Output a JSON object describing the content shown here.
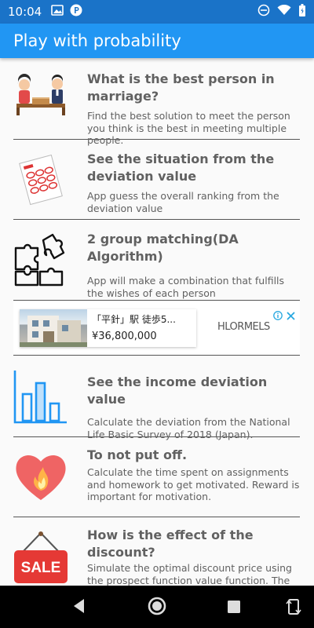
{
  "status_bar": {
    "time": "10:04",
    "left_icons": [
      "image-icon",
      "p-app-icon"
    ],
    "right_icons": [
      "do-not-disturb-icon",
      "wifi-icon",
      "battery-icon"
    ]
  },
  "app_bar": {
    "title": "Play with probability",
    "color": "#2196f3",
    "status_color": "#1a73c8"
  },
  "items": [
    {
      "title_line1": "What is the best person in",
      "title_line2": "marriage?",
      "desc": "Find the best solution to meet the person you think is the best in meeting multiple people.",
      "icon": "couple-meeting-icon"
    },
    {
      "title_line1": "See the situation from the",
      "title_line2": "deviation value",
      "desc": "App guess the overall ranking from the deviation value",
      "icon": "exam-sheet-icon"
    },
    {
      "title_line1": "2 group matching(DA Algorithm)",
      "title_line2": "",
      "desc": "App will make a combination that fulfills the wishes of each person",
      "icon": "puzzle-icon"
    },
    {
      "title_line1": "See the income deviation value",
      "title_line2": "",
      "desc": "Calculate the deviation from the National Life Basic Survey of 2018 (Japan).",
      "icon": "bar-chart-icon"
    },
    {
      "title_line1": "To not put off.",
      "title_line2": "",
      "desc": "Calculate the time spent on assignments and homework to get motivated. Reward is important for motivation.",
      "icon": "heart-flame-icon"
    },
    {
      "title_line1": "How is the effect of the discount?",
      "title_line2": "",
      "desc": "Simulate the optimal discount price using the prospect function value function. The disadvantage is that the optimal price is not",
      "icon": "sale-sign-icon"
    }
  ],
  "ad": {
    "line1": "「平針」駅 徒歩5...",
    "price": "¥36,800,000",
    "brand": "HLORMELS"
  },
  "nav": {
    "buttons": [
      "back-icon",
      "home-icon",
      "recents-icon",
      "rotate-icon"
    ]
  }
}
